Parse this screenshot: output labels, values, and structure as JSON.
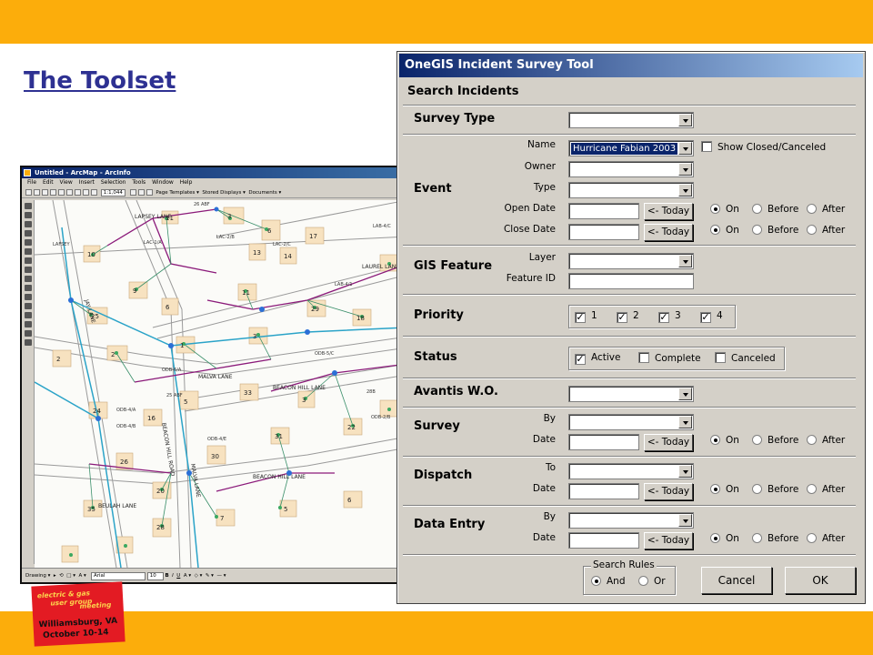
{
  "slide": {
    "title": "The Toolset",
    "logo": {
      "line1": "electric & gas",
      "line2": "user group",
      "line3": "meeting",
      "line4": "Williamsburg, VA",
      "line5": "October 10-14"
    },
    "colors": {
      "band": "#fcad0b",
      "title": "#2e3192",
      "logo_bg": "#e31b23"
    }
  },
  "arcmap": {
    "window_title": "Untitled - ArcMap - ArcInfo",
    "menu": [
      "File",
      "Edit",
      "View",
      "Insert",
      "Selection",
      "Tools",
      "Window",
      "Help"
    ],
    "toolbar": {
      "scale": "1:1,044",
      "page_templates": "Page Templates",
      "stored_displays": "Stored Displays",
      "documents": "Documents"
    },
    "drawing_toolbar": {
      "drawing": "Drawing",
      "font": "Arial",
      "font_size": "10",
      "bold": "B",
      "italic": "I",
      "underline": "U"
    },
    "street_labels": [
      "LAPSEY LANE",
      "LAUREL LANE",
      "MALVA LANE",
      "BEACON HILL LANE",
      "BEACON HILL ROAD",
      "BEULAH LANE",
      "JAY LANE",
      "BEACON HILL LANE",
      "MALVA LANE"
    ],
    "lot_numbers": [
      "3",
      "6",
      "17",
      "14",
      "13",
      "11",
      "10",
      "9",
      "25",
      "6",
      "11",
      "29",
      "18",
      "2",
      "2",
      "1",
      "3",
      "5",
      "33",
      "3",
      "24",
      "16",
      "26",
      "30",
      "31",
      "22",
      "35",
      "20",
      "28",
      "7",
      "5",
      "6"
    ],
    "facility_labels": [
      "LAFSEY",
      "LAC-1/A",
      "LAC-2/B",
      "LAC-2/C",
      "LAB-4/C",
      "LAB-4/1",
      "ODB-4/A",
      "ODB-4/B",
      "ODB-5/C",
      "ODB-6/A",
      "ODB-4/E",
      "ODB-2/B",
      "26 ABF",
      "25 ABF",
      "28B"
    ]
  },
  "dialog": {
    "title": "OneGIS Incident Survey Tool",
    "search_header": "Search Incidents",
    "sections": {
      "survey_type": "Survey Type",
      "event": "Event",
      "gis_feature": "GIS Feature",
      "priority": "Priority",
      "status": "Status",
      "avantis": "Avantis W.O.",
      "survey": "Survey",
      "dispatch": "Dispatch",
      "data_entry": "Data Entry"
    },
    "labels": {
      "name": "Name",
      "owner": "Owner",
      "type": "Type",
      "open_date": "Open Date",
      "close_date": "Close Date",
      "layer": "Layer",
      "feature_id": "Feature ID",
      "by": "By",
      "date": "Date",
      "to": "To"
    },
    "event_name_value": "Hurricane Fabian 2003",
    "show_closed_label": "Show Closed/Canceled",
    "today_label": "<- Today",
    "radio": {
      "on": "On",
      "before": "Before",
      "after": "After"
    },
    "priority": [
      "1",
      "2",
      "3",
      "4"
    ],
    "status": [
      "Active",
      "Complete",
      "Canceled"
    ],
    "search_rules": {
      "legend": "Search Rules",
      "and": "And",
      "or": "Or"
    },
    "buttons": {
      "cancel": "Cancel",
      "ok": "OK"
    }
  }
}
